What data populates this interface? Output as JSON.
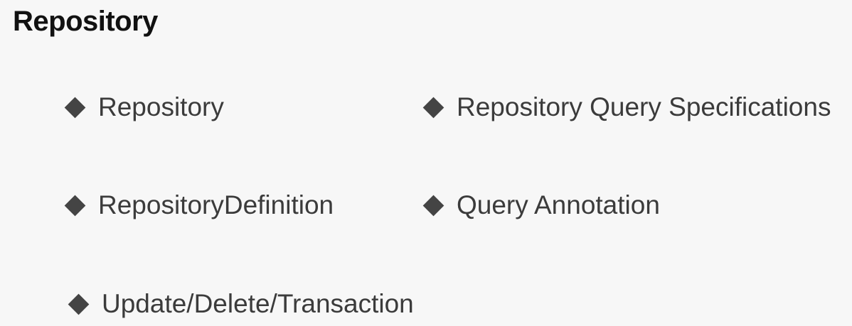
{
  "slide": {
    "title": "Repository",
    "bullet_icon": "diamond-bullet-icon",
    "bullets": [
      {
        "label": "Repository"
      },
      {
        "label": "Repository Query Specifications"
      },
      {
        "label": "RepositoryDefinition"
      },
      {
        "label": "Query Annotation"
      },
      {
        "label": "Update/Delete/Transaction"
      }
    ]
  }
}
